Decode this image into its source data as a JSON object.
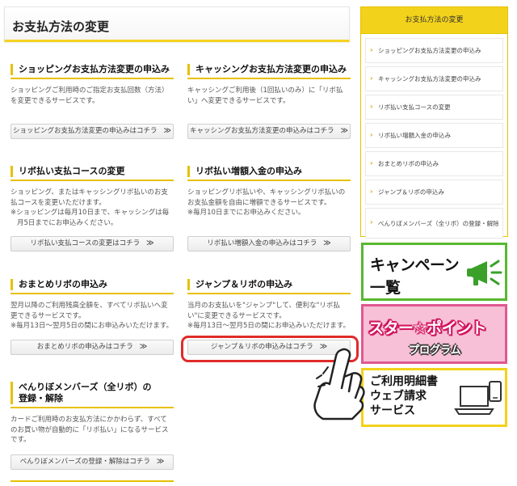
{
  "page": {
    "title": "お支払方法の変更"
  },
  "sections": [
    {
      "heading": "ショッピングお支払方法変更の申込み",
      "desc": [
        "ショッピングご利用時のご指定お支払回数（方法）を変更できるサービスです。"
      ],
      "notes": [],
      "button": "ショッピングお支払方法変更の申込みはコチラ"
    },
    {
      "heading": "キャッシングお支払方法変更の申込み",
      "desc": [
        "キャッシングご利用後（1回払いのみ）に「リボ払い」へ変更できるサービスです。"
      ],
      "notes": [],
      "button": "キャッシングお支払方法変更の申込みはコチラ"
    },
    {
      "heading": "リボ払い支払コースの変更",
      "desc": [
        "ショッピング、またはキャッシングリボ払いのお支払コースを変更いただけます。"
      ],
      "notes": [
        "※ショッピングは毎月10日まで、キャッシングは毎月5日までにお申込みください。"
      ],
      "button": "リボ払い支払コースの変更はコチラ"
    },
    {
      "heading": "リボ払い増額入金の申込み",
      "desc": [
        "ショッピングリボ払いや、キャッシングリボ払いのお支払金額を自由に増額できるサービスです。"
      ],
      "notes": [
        "※毎月10日までにお申込みください。"
      ],
      "button": "リボ払い増額入金の申込みはコチラ"
    },
    {
      "heading": "おまとめリボの申込み",
      "desc": [
        "翌月以降のご利用残高全額を、すべてリボ払いへ変更できるサービスです。"
      ],
      "notes": [
        "※毎月13日～翌月5日の間にお申込みいただけます。"
      ],
      "button": "おまとめリボの申込みはコチラ"
    },
    {
      "heading": "ジャンプ＆リボの申込み",
      "desc": [
        "当月のお支払いを\"ジャンプ\"して、便利な\"リボ払い\"に変更できるサービスです。"
      ],
      "notes": [
        "※毎月13日～翌月5日の間にお申込みいただけます。"
      ],
      "button": "ジャンプ＆リボの申込みはコチラ"
    },
    {
      "heading_lines": [
        "べんりぼメンバーズ（全リボ）の",
        "登録・解除"
      ],
      "desc": [
        "カードご利用時のお支払方法にかかわらず、すべてのお買い物が自動的に「リボ払い」になるサービスです。"
      ],
      "notes": [],
      "button": "べんりぼメンバーズの登録・解除はコチラ"
    }
  ],
  "button_arrow": "≫",
  "sidebar": {
    "title": "お支払方法の変更",
    "items": [
      "ショッピングお支払方法変更の申込み",
      "キャッシングお支払方法変更の申込み",
      "リボ払い支払コースの変更",
      "リボ払い増額入金の申込み",
      "おまとめリボの申込み",
      "ジャンプ＆リボの申込み",
      "べんりぼメンバーズ（全リボ）の登録・解除"
    ]
  },
  "banners": {
    "campaign": [
      "キャンペーン",
      "一覧"
    ],
    "star_point": [
      "スター☆ポイント",
      "プログラム"
    ],
    "web_statement": [
      "ご利用明細書",
      "ウェブ請求",
      "サービス"
    ]
  },
  "colors": {
    "accent": "#f3d21b",
    "highlight": "#e02a2a",
    "campaign_border": "#58b82e",
    "star_pink": "#e05891"
  },
  "icons": {
    "sidebar_chevron": "chevron-right-icon",
    "megaphone": "megaphone-icon",
    "laptop": "laptop-icon",
    "hand": "pointing-hand-icon"
  }
}
